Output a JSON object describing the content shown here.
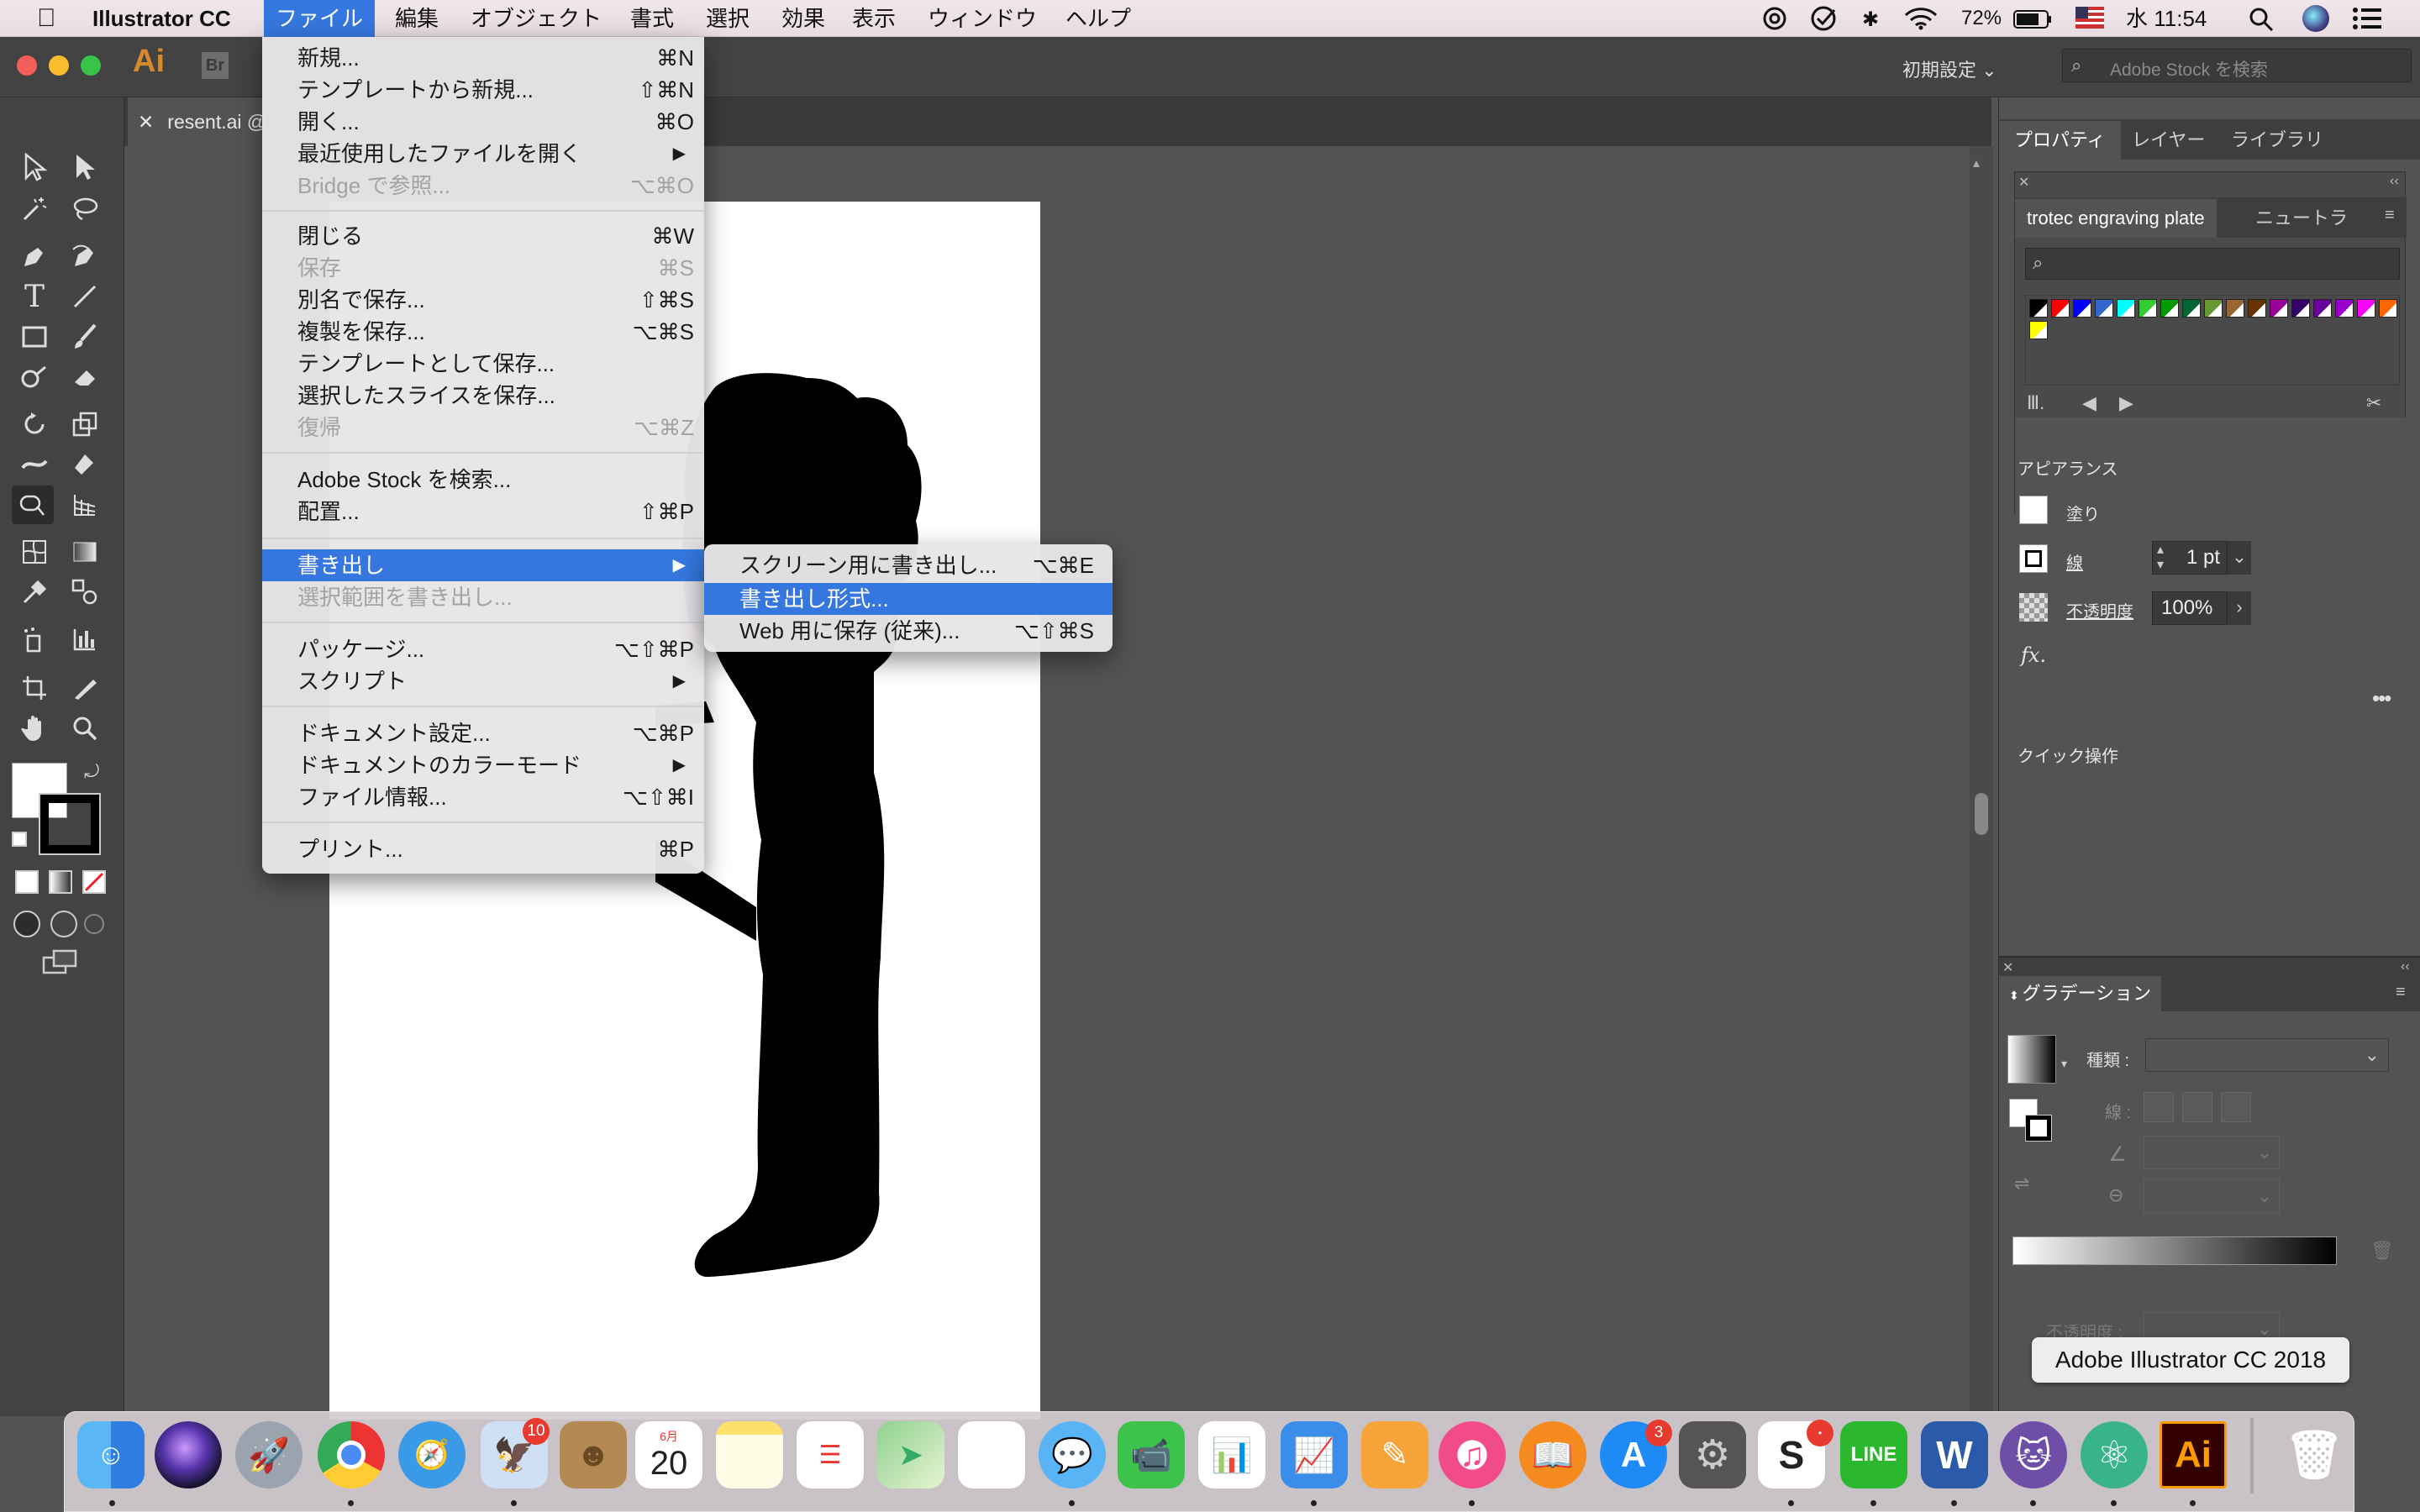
{
  "menubar": {
    "app_name": "Illustrator CC",
    "menus": [
      "ファイル",
      "編集",
      "オブジェクト",
      "書式",
      "選択",
      "効果",
      "表示",
      "ウィンドウ",
      "ヘルプ"
    ],
    "battery": "72%",
    "clock": "水 11:54"
  },
  "topbar": {
    "app_icon": "Ai",
    "bridge_icon": "Br",
    "workspace": "初期設定",
    "search_placeholder": "Adobe Stock を検索"
  },
  "doc_tab": {
    "title": "resent.ai @"
  },
  "file_menu": {
    "items": [
      {
        "label": "新規...",
        "shortcut": "⌘N"
      },
      {
        "label": "テンプレートから新規...",
        "shortcut": "⇧⌘N"
      },
      {
        "label": "開く...",
        "shortcut": "⌘O"
      },
      {
        "label": "最近使用したファイルを開く",
        "shortcut": "▶"
      },
      {
        "label": "Bridge で参照...",
        "shortcut": "⌥⌘O"
      },
      {
        "label": "閉じる",
        "shortcut": "⌘W"
      },
      {
        "label": "保存",
        "shortcut": "⌘S"
      },
      {
        "label": "別名で保存...",
        "shortcut": "⇧⌘S"
      },
      {
        "label": "複製を保存...",
        "shortcut": "⌥⌘S"
      },
      {
        "label": "テンプレートとして保存...",
        "shortcut": ""
      },
      {
        "label": "選択したスライスを保存...",
        "shortcut": ""
      },
      {
        "label": "復帰",
        "shortcut": "⌥⌘Z"
      },
      {
        "label": "Adobe Stock を検索...",
        "shortcut": ""
      },
      {
        "label": "配置...",
        "shortcut": "⇧⌘P"
      },
      {
        "label": "書き出し",
        "shortcut": "▶"
      },
      {
        "label": "選択範囲を書き出し...",
        "shortcut": ""
      },
      {
        "label": "パッケージ...",
        "shortcut": "⌥⇧⌘P"
      },
      {
        "label": "スクリプト",
        "shortcut": "▶"
      },
      {
        "label": "ドキュメント設定...",
        "shortcut": "⌥⌘P"
      },
      {
        "label": "ドキュメントのカラーモード",
        "shortcut": "▶"
      },
      {
        "label": "ファイル情報...",
        "shortcut": "⌥⇧⌘I"
      },
      {
        "label": "プリント...",
        "shortcut": "⌘P"
      }
    ]
  },
  "export_submenu": {
    "items": [
      {
        "label": "スクリーン用に書き出し...",
        "shortcut": "⌥⌘E"
      },
      {
        "label": "書き出し形式...",
        "shortcut": ""
      },
      {
        "label": "Web 用に保存 (従来)...",
        "shortcut": "⌥⇧⌘S"
      }
    ]
  },
  "right_panel": {
    "tabs": [
      "プロパティ",
      "レイヤー",
      "ライブラリ"
    ],
    "swatch_tabs": [
      "trotec engraving plate",
      "ニュートラ"
    ],
    "swatch_colors": [
      "#000000",
      "#ff0000",
      "#0000ff",
      "#3366cc",
      "#00ffff",
      "#33cc33",
      "#009900",
      "#006633",
      "#669933",
      "#996633",
      "#663300",
      "#990099",
      "#330066",
      "#660099",
      "#9900cc",
      "#ff00ff",
      "#ff6600",
      "#ffff00"
    ],
    "appearance_title": "アピアランス",
    "fill_label": "塗り",
    "stroke_label": "線",
    "stroke_value": "1 pt",
    "opacity_label": "不透明度",
    "opacity_value": "100%",
    "fx_label": "fx.",
    "quick_actions": "クイック操作"
  },
  "gradient_panel": {
    "title": "グラデーション",
    "type_label": "種類 :",
    "stroke_label": "線 :",
    "opacity_label": "不透明度 :"
  },
  "dock": {
    "tooltip": "Adobe Illustrator CC 2018",
    "calendar_month": "6月",
    "calendar_day": "20",
    "badge_mail": "10",
    "badge_appstore": "3",
    "line_label": "LINE",
    "word_label": "W",
    "ai_label": "Ai"
  }
}
